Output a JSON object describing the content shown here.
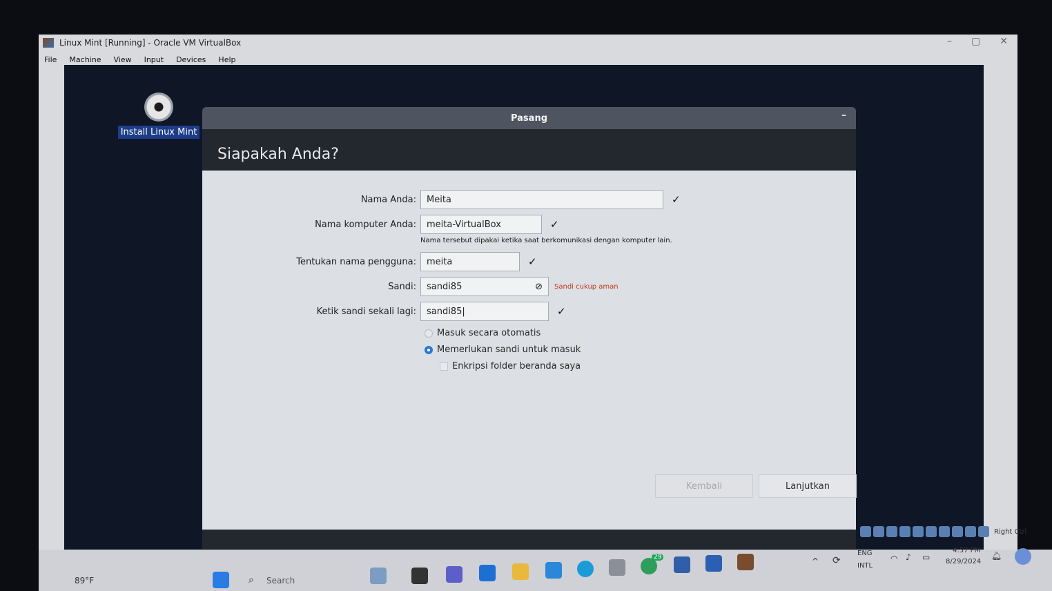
{
  "host": {
    "title": "Linux Mint [Running] - Oracle VM VirtualBox",
    "menu": [
      "File",
      "Machine",
      "View",
      "Input",
      "Devices",
      "Help"
    ],
    "controls": [
      "–",
      "▢",
      "✕"
    ]
  },
  "desktop": {
    "install_label": "Install Linux Mint"
  },
  "dialog": {
    "title": "Pasang",
    "minimize": "–",
    "heading": "Siapakah Anda?",
    "fields": {
      "name_label": "Nama Anda:",
      "name_value": "Meita",
      "computer_label": "Nama komputer Anda:",
      "computer_value": "meita-VirtualBox",
      "computer_hint": "Nama tersebut dipakai ketika saat berkomunikasi dengan komputer lain.",
      "username_label": "Tentukan nama pengguna:",
      "username_value": "meita",
      "password_label": "Sandi:",
      "password_value": "sandi85",
      "password_strength": "Sandi cukup aman",
      "confirm_label": "Ketik sandi sekali lagi:",
      "confirm_value": "sandi85|"
    },
    "options": {
      "auto_login": "Masuk secara otomatis",
      "require_password": "Memerlukan sandi untuk masuk",
      "encrypt_home": "Enkripsi folder beranda saya"
    },
    "buttons": {
      "back": "Kembali",
      "next": "Lanjutkan"
    },
    "check_mark": "✓",
    "eye_glyph": "⊘"
  },
  "taskbar": {
    "weather": "89°F",
    "search": "Search",
    "whatsapp_badge": "29",
    "language_1": "ENG",
    "language_2": "INTL",
    "time": "4:57 PM",
    "date": "8/29/2024",
    "right_ctrl": "Right Ctrl"
  }
}
